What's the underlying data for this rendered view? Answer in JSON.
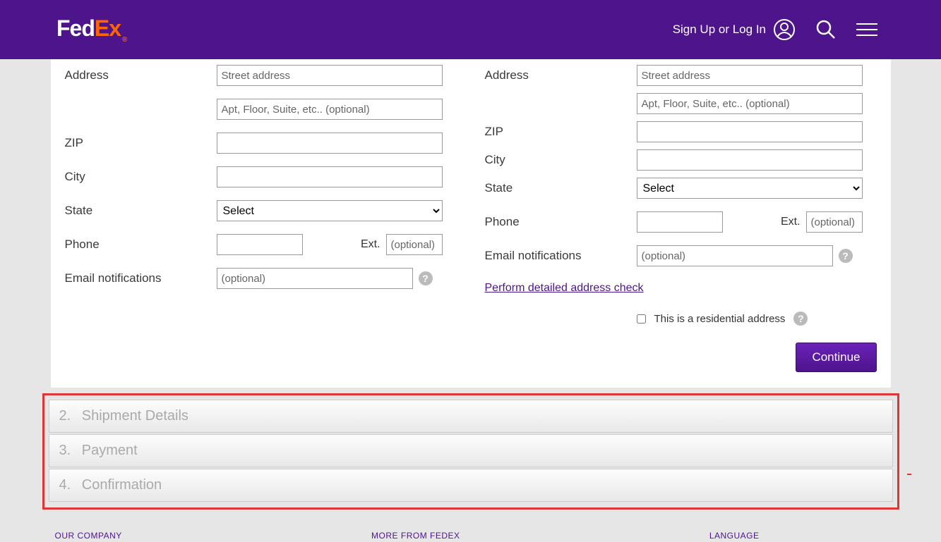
{
  "header": {
    "logo_fed": "Fed",
    "logo_ex": "Ex",
    "logo_reg": "®",
    "signin": "Sign Up or Log In"
  },
  "form": {
    "from": {
      "address_label": "Address",
      "street_placeholder": "Street address",
      "apt_placeholder": "Apt, Floor, Suite, etc.. (optional)",
      "zip_label": "ZIP",
      "city_label": "City",
      "state_label": "State",
      "state_select": "Select",
      "phone_label": "Phone",
      "ext_label": "Ext.",
      "ext_placeholder": "(optional)",
      "email_label": "Email notifications",
      "email_placeholder": "(optional)"
    },
    "to": {
      "address_label": "Address",
      "street_placeholder": "Street address",
      "apt_placeholder": "Apt, Floor, Suite, etc.. (optional)",
      "zip_label": "ZIP",
      "city_label": "City",
      "state_label": "State",
      "state_select": "Select",
      "phone_label": "Phone",
      "ext_label": "Ext.",
      "ext_placeholder": "(optional)",
      "email_label": "Email notifications",
      "email_placeholder": "(optional)",
      "address_check": "Perform detailed address check",
      "residential_label": "This is a residential address"
    },
    "continue": "Continue"
  },
  "steps": {
    "s2_num": "2.",
    "s2_label": "Shipment Details",
    "s3_num": "3.",
    "s3_label": "Payment",
    "s4_num": "4.",
    "s4_label": "Confirmation"
  },
  "footer": {
    "col1": "OUR COMPANY",
    "col2": "MORE FROM FEDEX",
    "col3": "LANGUAGE"
  }
}
